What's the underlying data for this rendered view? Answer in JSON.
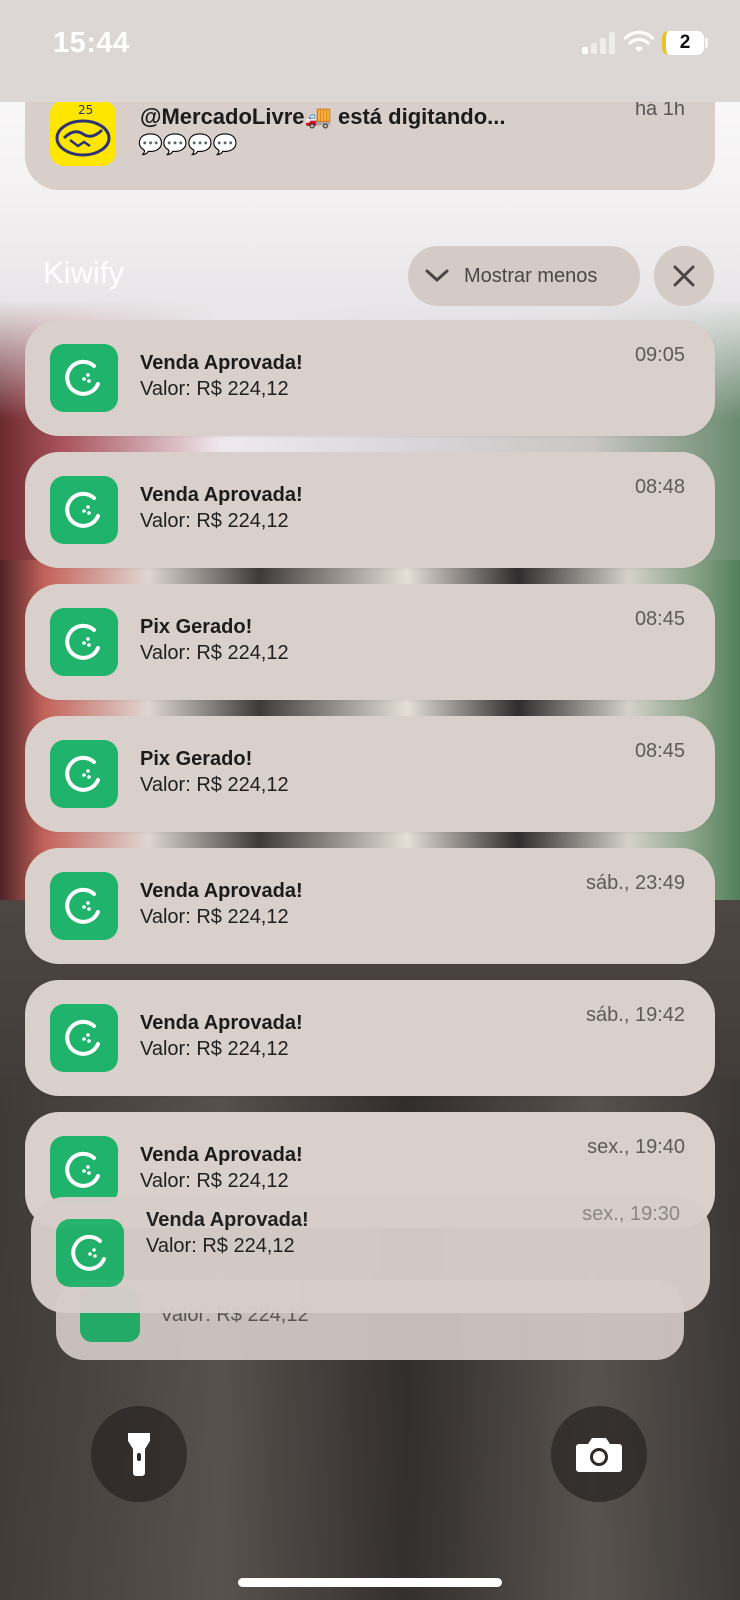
{
  "status_bar": {
    "time": "15:44",
    "battery_level": "2"
  },
  "top_notification": {
    "app": "MercadoLivre",
    "title": "@MercadoLivre🚚 está digitando...",
    "subtitle": "💬💬💬💬",
    "time": "há 1h"
  },
  "group": {
    "title": "Kiwify",
    "show_less_label": "Mostrar menos",
    "close_icon": "close-icon"
  },
  "notifications": [
    {
      "title": "Venda Aprovada!",
      "body": "Valor: R$ 224,12",
      "time": "09:05"
    },
    {
      "title": "Venda Aprovada!",
      "body": "Valor: R$ 224,12",
      "time": "08:48"
    },
    {
      "title": "Pix Gerado!",
      "body": "Valor: R$ 224,12",
      "time": "08:45"
    },
    {
      "title": "Pix Gerado!",
      "body": "Valor: R$ 224,12",
      "time": "08:45"
    },
    {
      "title": "Venda Aprovada!",
      "body": "Valor: R$ 224,12",
      "time": "sáb., 23:49"
    },
    {
      "title": "Venda Aprovada!",
      "body": "Valor: R$ 224,12",
      "time": "sáb., 19:42"
    },
    {
      "title": "Venda Aprovada!",
      "body": "Valor: R$ 224,12",
      "time": "sex., 19:40"
    }
  ],
  "stacked": [
    {
      "title": "Venda Aprovada!",
      "body": "Valor: R$ 224,12",
      "time": "sex., 19:30"
    },
    {
      "body": "Valor: R$ 224,12"
    }
  ],
  "quick_actions": {
    "left": "flashlight-icon",
    "right": "camera-icon"
  },
  "colors": {
    "kiwify_green": "#20b36b",
    "card_bg": "#d9cfcb",
    "ml_yellow": "#ffe600"
  }
}
